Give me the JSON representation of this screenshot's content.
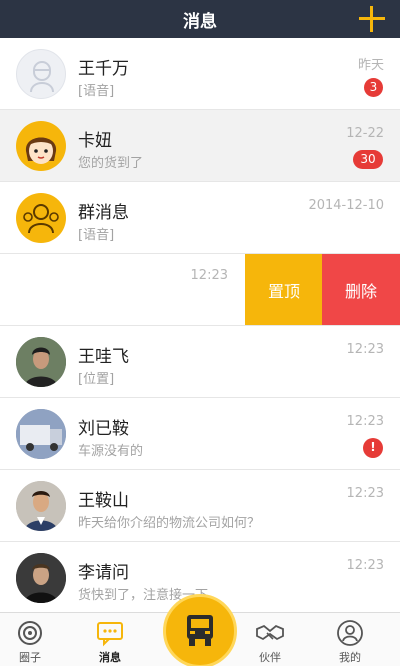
{
  "header": {
    "title": "消息",
    "add_icon": "plus-icon"
  },
  "conversations": [
    {
      "name": "王千万",
      "message": "[语音]",
      "time": "昨天",
      "badge": "3",
      "avatar": "placeholder-avatar"
    },
    {
      "name": "卡妞",
      "message": "您的货到了",
      "time": "12-22",
      "badge": "30",
      "avatar": "girl-avatar"
    },
    {
      "name": "群消息",
      "message": "[语音]",
      "time": "2014-12-10",
      "badge": "",
      "avatar": "group-avatar"
    },
    {
      "name": "",
      "message": "",
      "time": "12:23",
      "badge": ""
    },
    {
      "name": "王哇飞",
      "message": "[位置]",
      "time": "12:23",
      "badge": "",
      "avatar": "photo-avatar"
    },
    {
      "name": "刘已鞍",
      "message": "车源没有的",
      "time": "12:23",
      "badge": "!",
      "avatar": "truck-photo-avatar"
    },
    {
      "name": "王鞍山",
      "message": "昨天给你介绍的物流公司如何？",
      "time": "12:23",
      "badge": "",
      "avatar": "photo-avatar"
    },
    {
      "name": "李请问",
      "message": "货快到了，注意接一下",
      "time": "12:23",
      "badge": "",
      "avatar": "photo-avatar"
    }
  ],
  "swipe_actions": {
    "pin": "置顶",
    "delete": "删除"
  },
  "tabbar": {
    "tabs": [
      {
        "label": "圈子",
        "icon": "circle-icon"
      },
      {
        "label": "消息",
        "icon": "message-icon",
        "active": true
      },
      {
        "label": "",
        "icon": "truck-icon"
      },
      {
        "label": "伙伴",
        "icon": "handshake-icon"
      },
      {
        "label": "我的",
        "icon": "profile-icon"
      }
    ]
  },
  "colors": {
    "header_bg": "#2c3444",
    "accent": "#f6b60b",
    "delete": "#f04747",
    "badge": "#e63b37"
  }
}
